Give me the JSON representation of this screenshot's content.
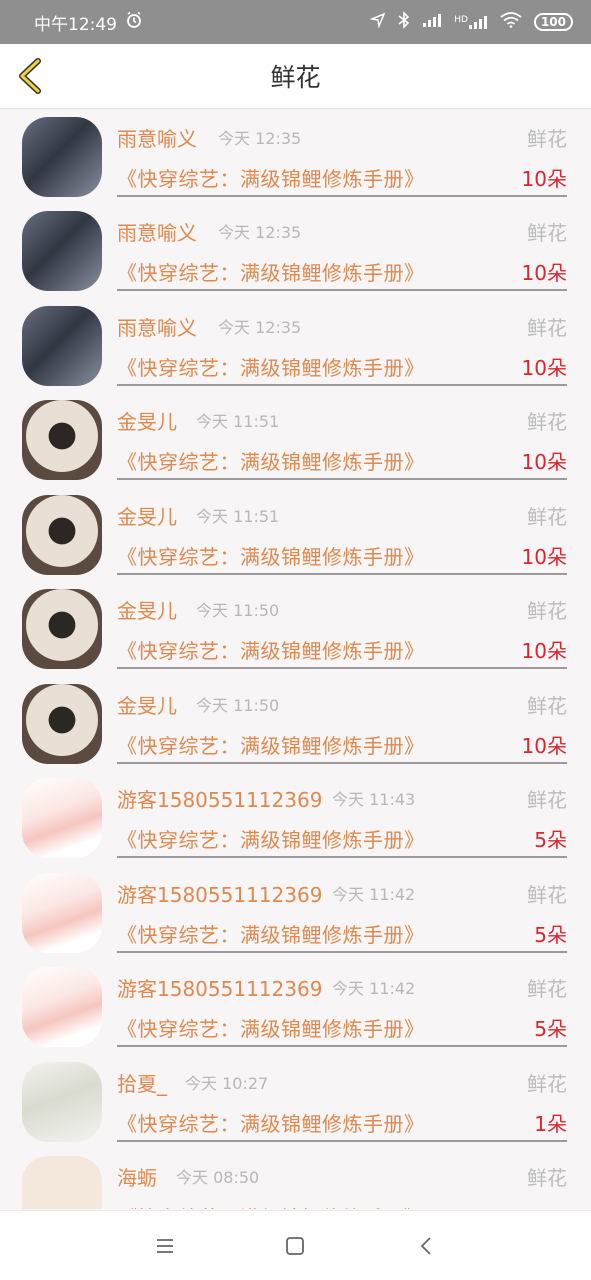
{
  "statusbar": {
    "time": "中午12:49",
    "alarm": "alarm-icon",
    "hd": "HD",
    "battery": "100"
  },
  "header": {
    "title": "鲜花",
    "back_icon": "chevron-left-icon"
  },
  "rows": [
    {
      "name": "雨意喻义",
      "time": "今天 12:35",
      "type": "鲜花",
      "book": "《快穿综艺：满级锦鲤修炼手册》",
      "count": "10朵",
      "avatar": "a"
    },
    {
      "name": "雨意喻义",
      "time": "今天 12:35",
      "type": "鲜花",
      "book": "《快穿综艺：满级锦鲤修炼手册》",
      "count": "10朵",
      "avatar": "a"
    },
    {
      "name": "雨意喻义",
      "time": "今天 12:35",
      "type": "鲜花",
      "book": "《快穿综艺：满级锦鲤修炼手册》",
      "count": "10朵",
      "avatar": "a"
    },
    {
      "name": "金旻儿",
      "time": "今天 11:51",
      "type": "鲜花",
      "book": "《快穿综艺：满级锦鲤修炼手册》",
      "count": "10朵",
      "avatar": "b"
    },
    {
      "name": "金旻儿",
      "time": "今天 11:51",
      "type": "鲜花",
      "book": "《快穿综艺：满级锦鲤修炼手册》",
      "count": "10朵",
      "avatar": "b"
    },
    {
      "name": "金旻儿",
      "time": "今天 11:50",
      "type": "鲜花",
      "book": "《快穿综艺：满级锦鲤修炼手册》",
      "count": "10朵",
      "avatar": "b"
    },
    {
      "name": "金旻儿",
      "time": "今天 11:50",
      "type": "鲜花",
      "book": "《快穿综艺：满级锦鲤修炼手册》",
      "count": "10朵",
      "avatar": "b"
    },
    {
      "name": "游客1580551112369",
      "time": "今天 11:43",
      "type": "鲜花",
      "book": "《快穿综艺：满级锦鲤修炼手册》",
      "count": "5朵",
      "avatar": "c"
    },
    {
      "name": "游客1580551112369",
      "time": "今天 11:42",
      "type": "鲜花",
      "book": "《快穿综艺：满级锦鲤修炼手册》",
      "count": "5朵",
      "avatar": "c"
    },
    {
      "name": "游客1580551112369",
      "time": "今天 11:42",
      "type": "鲜花",
      "book": "《快穿综艺：满级锦鲤修炼手册》",
      "count": "5朵",
      "avatar": "c"
    },
    {
      "name": "拾夏_",
      "time": "今天 10:27",
      "type": "鲜花",
      "book": "《快穿综艺：满级锦鲤修炼手册》",
      "count": "1朵",
      "avatar": "d"
    },
    {
      "name": "海蛎",
      "time": "今天 08:50",
      "type": "鲜花",
      "book": "《快穿综艺：满级锦鲤修炼手册》",
      "count": "",
      "avatar": "e"
    }
  ],
  "navbar": {
    "menu_icon": "menu-icon",
    "home_icon": "home-square-icon",
    "back_icon": "back-triangle-icon"
  }
}
